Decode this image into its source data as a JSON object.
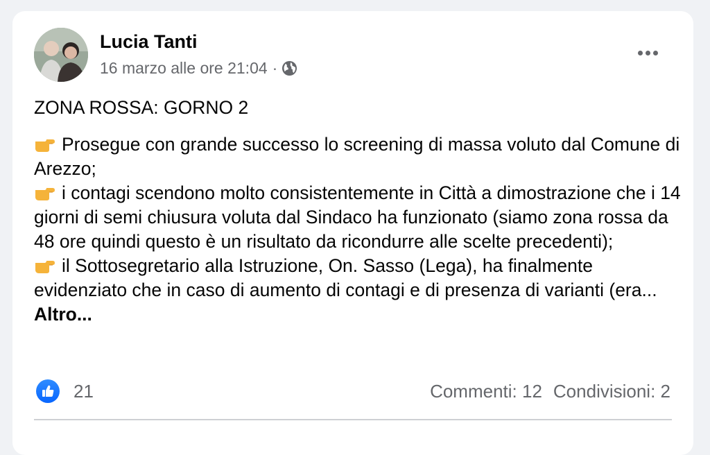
{
  "post": {
    "author": "Lucia Tanti",
    "timestamp": "16 marzo alle ore 21:04",
    "separator": "·",
    "privacy_icon": "globe-icon",
    "menu_icon": "more-options-icon",
    "headline": "ZONA ROSSA: GORNO 2",
    "bullet_icon": "pointing-hand-emoji",
    "paragraphs": [
      "Prosegue con grande successo lo screening di massa voluto dal Comune di Arezzo;",
      "i contagi scendono molto consistentemente in Città a dimostrazione che i 14 giorni di semi chiusura voluta dal Sindaco ha funzionato (siamo zona rossa da 48 ore quindi questo è un risultato da ricondurre alle scelte precedenti);",
      "il Sottosegretario alla Istruzione, On. Sasso (Lega), ha finalmente evidenziato che in caso di aumento di contagi e di presenza di varianti (era..."
    ],
    "see_more": "Altro..."
  },
  "reactions": {
    "icon": "like-icon",
    "count": "21"
  },
  "stats": {
    "comments": "Commenti: 12",
    "shares": "Condivisioni: 2"
  },
  "colors": {
    "background": "#f0f2f5",
    "card": "#ffffff",
    "secondary_text": "#65676b",
    "like_blue": "#0866ff",
    "hand_emoji": "#f5b33a"
  }
}
